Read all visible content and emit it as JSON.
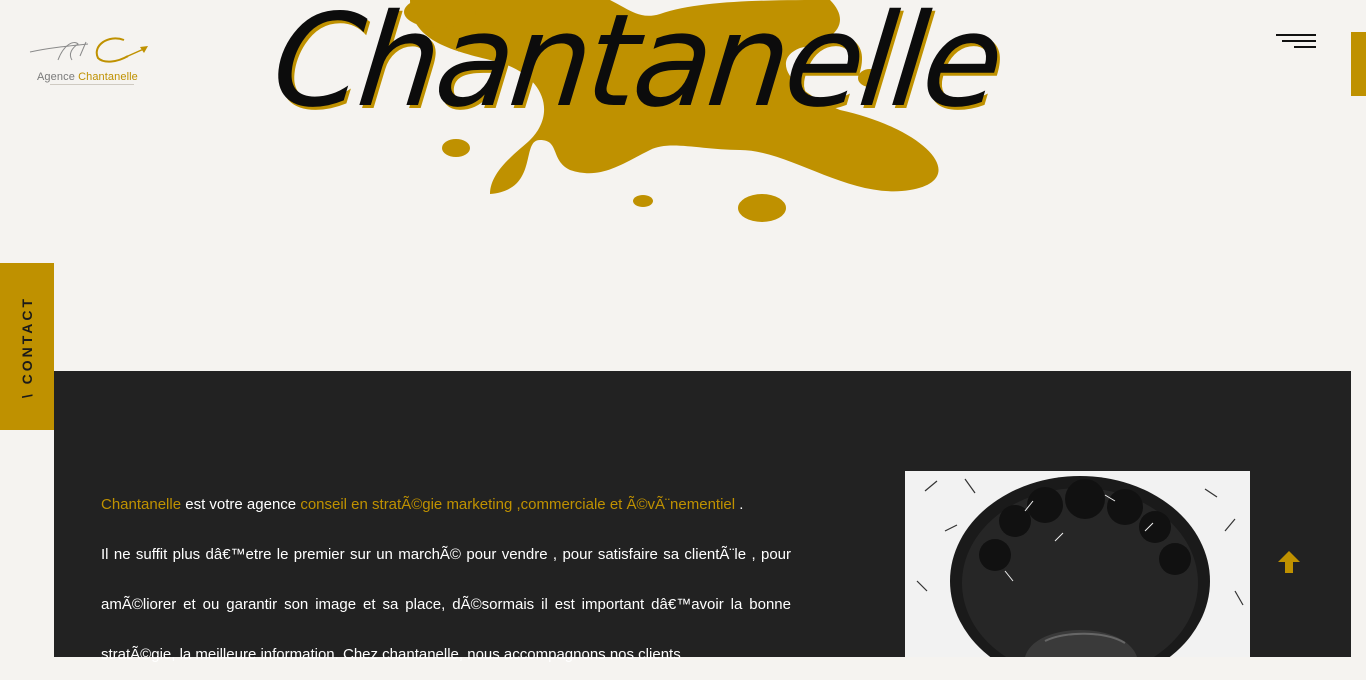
{
  "logo": {
    "word1": "Agence",
    "word2": "Chantanelle"
  },
  "hero": {
    "title": "Chantanelle"
  },
  "contact_tab": {
    "label": "\\ CONTACT"
  },
  "intro": {
    "brand": "Chantanelle",
    "text1": " est votre agence ",
    "highlight": "conseil en stratÃ©gie marketing ,commerciale et Ã©vÃ¨nementiel",
    "text2": " .",
    "line2": "Il ne suffit plus dâ€™etre le premier sur un marchÃ© pour vendre , pour satisfaire sa clientÃ¨le , pour amÃ©liorer et ou garantir son image et sa place, dÃ©sormais il est important dâ€™avoir la bonne stratÃ©gie, la meilleure information. Chez chantanelle, nous accompagnons nos clients"
  },
  "colors": {
    "accent": "#bf9100",
    "background": "#f5f3f0",
    "dark": "#222222"
  },
  "icons": {
    "menu": "hamburger-icon",
    "scroll_top": "arrow-up-icon"
  }
}
